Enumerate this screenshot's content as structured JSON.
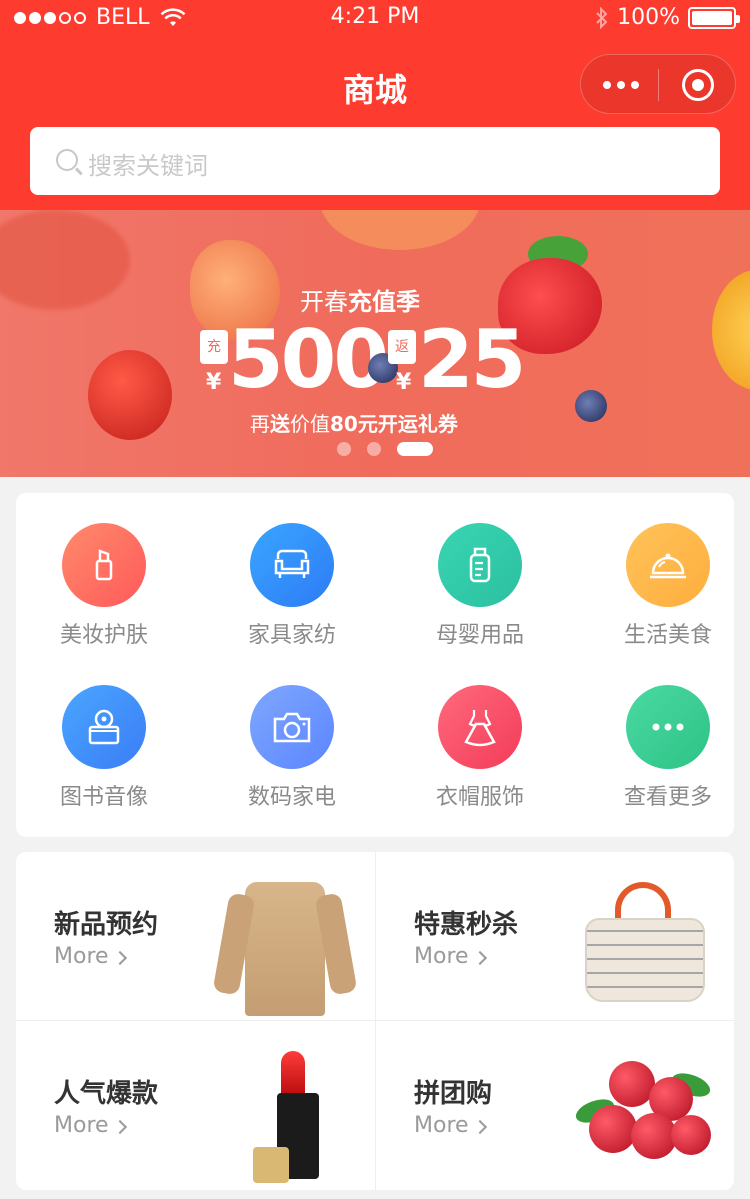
{
  "status": {
    "carrier": "BELL",
    "time": "4:21 PM",
    "battery": "100%"
  },
  "header": {
    "title": "商城"
  },
  "search": {
    "placeholder": "搜索关键词"
  },
  "banner": {
    "subtitle_prefix": "开春",
    "subtitle_bold": "充值季",
    "tag_charge": "充",
    "tag_return": "返",
    "currency": "¥",
    "amount_charge": "500",
    "amount_return": "25",
    "line_prefix": "再",
    "line_bold1": "送",
    "line_mid": "价值",
    "line_bold2": "80元开运礼券",
    "pages": 3,
    "active_page": 3
  },
  "categories": [
    {
      "label": "美妆护肤",
      "icon": "lipstick-icon"
    },
    {
      "label": "家具家纺",
      "icon": "sofa-icon"
    },
    {
      "label": "母婴用品",
      "icon": "baby-bottle-icon"
    },
    {
      "label": "生活美食",
      "icon": "food-cloche-icon"
    },
    {
      "label": "图书音像",
      "icon": "book-disc-icon"
    },
    {
      "label": "数码家电",
      "icon": "camera-icon"
    },
    {
      "label": "衣帽服饰",
      "icon": "dress-icon"
    },
    {
      "label": "查看更多",
      "icon": "more-icon"
    }
  ],
  "promos": [
    {
      "name": "新品预约",
      "more": "More"
    },
    {
      "name": "特惠秒杀",
      "more": "More"
    },
    {
      "name": "人气爆款",
      "more": "More"
    },
    {
      "name": "拼团购",
      "more": "More"
    }
  ],
  "colors": {
    "brand": "#fe3b2f",
    "banner": "#f06b5b"
  }
}
